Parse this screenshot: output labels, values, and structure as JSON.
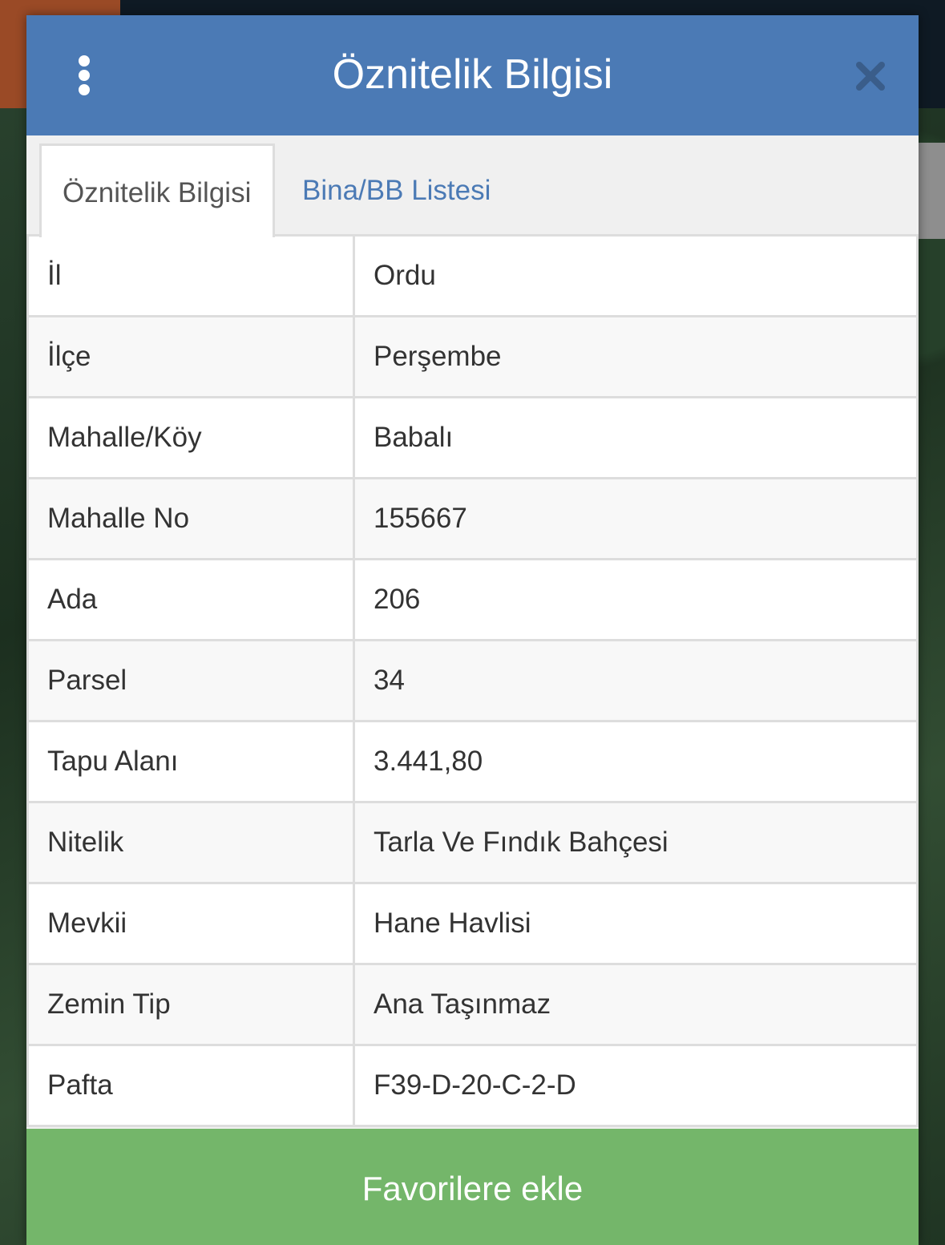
{
  "modal": {
    "title": "Öznitelik Bilgisi"
  },
  "tabs": [
    {
      "label": "Öznitelik Bilgisi",
      "active": true
    },
    {
      "label": "Bina/BB Listesi",
      "active": false
    }
  ],
  "attributes": [
    {
      "key": "İl",
      "value": "Ordu"
    },
    {
      "key": "İlçe",
      "value": "Perşembe"
    },
    {
      "key": "Mahalle/Köy",
      "value": "Babalı"
    },
    {
      "key": "Mahalle No",
      "value": "155667"
    },
    {
      "key": "Ada",
      "value": "206"
    },
    {
      "key": "Parsel",
      "value": "34"
    },
    {
      "key": "Tapu Alanı",
      "value": "3.441,80"
    },
    {
      "key": "Nitelik",
      "value": "Tarla Ve Fındık Bahçesi"
    },
    {
      "key": "Mevkii",
      "value": "Hane Havlisi"
    },
    {
      "key": "Zemin Tip",
      "value": "Ana Taşınmaz"
    },
    {
      "key": "Pafta",
      "value": "F39-D-20-C-2-D"
    }
  ],
  "actions": {
    "favorite_label": "Favorilere ekle"
  },
  "icons": {
    "menu": "vertical-dots-icon",
    "close": "close-icon"
  },
  "colors": {
    "header": "#4b7ab5",
    "button": "#74b66a"
  }
}
